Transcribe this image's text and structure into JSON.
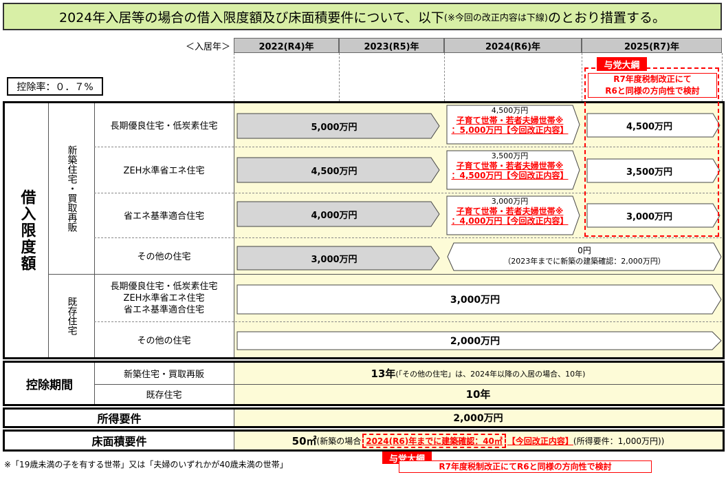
{
  "title": {
    "main_a": "2024年入居等の場合の借入限度額及び床面積要件について、以下",
    "note": "(※今回の改正内容は下線)",
    "main_b": "のとおり措置する。"
  },
  "header": {
    "label": "＜入居年＞",
    "years": [
      "2022(R4)年",
      "2023(R5)年",
      "2024(R6)年",
      "2025(R7)年"
    ]
  },
  "rate": "控除率：０．７%",
  "yotou_label": "与党大綱",
  "r7_note": [
    "R7年度税制改正にて",
    "R6と同様の方向性で検討"
  ],
  "limit": {
    "label": "借入限度額",
    "new_label": "新築住宅・買取再販",
    "existing_label": "既存住宅",
    "rows": [
      {
        "name": "長期優良住宅・低炭素住宅",
        "value": "5,000万円",
        "r6_base": "4,500万円",
        "r6_red": "子育て世帯・若者夫婦世帯※",
        "r6_change": "：5,000万円【今回改正内容】",
        "r7": "4,500万円"
      },
      {
        "name": "ZEH水準省エネ住宅",
        "value": "4,500万円",
        "r6_base": "3,500万円",
        "r6_red": "子育て世帯・若者夫婦世帯※",
        "r6_change": "：4,500万円【今回改正内容】",
        "r7": "3,500万円"
      },
      {
        "name": "省エネ基準適合住宅",
        "value": "4,000万円",
        "r6_base": "3,000万円",
        "r6_red": "子育て世帯・若者夫婦世帯※",
        "r6_change": "：4,000万円【今回改正内容】",
        "r7": "3,000万円"
      }
    ],
    "other": {
      "name": "その他の住宅",
      "value": "3,000万円",
      "r6": "0円",
      "r6_note": "（2023年までに新築の建築確認：2,000万円）"
    },
    "existing": [
      {
        "names": [
          "長期優良住宅・低炭素住宅",
          "ZEH水準省エネ住宅",
          "省エネ基準適合住宅"
        ],
        "value": "3,000万円"
      },
      {
        "names": [
          "その他の住宅"
        ],
        "value": "2,000万円"
      }
    ]
  },
  "period": {
    "label": "控除期間",
    "new_label": "新築住宅・買取再販",
    "new_value": "13年",
    "new_note": "(「その他の住宅」は、2024年以降の入居の場合、10年)",
    "existing_label": "既存住宅",
    "existing_value": "10年"
  },
  "income": {
    "label": "所得要件",
    "value": "2,000万円"
  },
  "floor": {
    "label": "床面積要件",
    "value": "50㎡",
    "note_a": "(新築の場合",
    "note_red": "2024(R6)年までに建築確認：40㎡",
    "note_red2": "【今回改正内容】",
    "note_b": "(所得要件：1,000万円))"
  },
  "footnote": "※「19歳未満の子を有する世帯」又は「夫婦のいずれかが40歳未満の世帯」"
}
